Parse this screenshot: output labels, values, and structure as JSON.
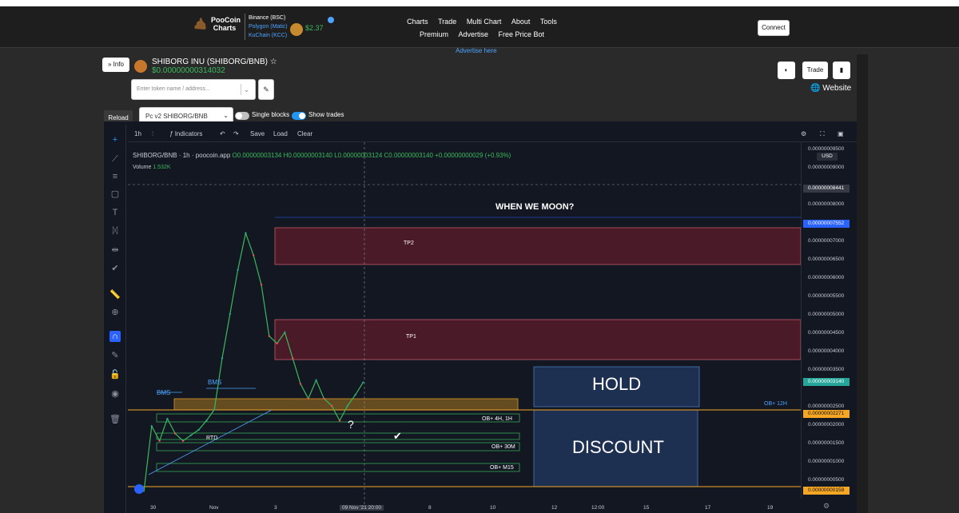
{
  "header": {
    "logo": {
      "line1": "PooCoin",
      "line2": "Charts"
    },
    "chains": [
      "Binance (BSC)",
      "Polygon (Matic)",
      "KuChain (KCC)"
    ],
    "poo_price": "$2.37",
    "nav_row1": [
      "Charts",
      "Trade",
      "Multi Chart",
      "About",
      "Tools"
    ],
    "nav_row2": [
      "Premium",
      "Advertise",
      "Free Price Bot"
    ],
    "connect_label": "Connect",
    "advertise_here": "Advertise here"
  },
  "token": {
    "info_label": "Info",
    "name": "SHIBORG INU (SHIBORG/BNB)",
    "price": "$0.00000000314032",
    "search_placeholder": "Enter token name / address...",
    "trade_label": "Trade",
    "website_label": "Website"
  },
  "controls": {
    "reload_label": "Reload",
    "pair_selected": "Pc v2 SHIBORG/BNB",
    "single_blocks_label": "Single blocks",
    "show_trades_label": "Show trades",
    "single_blocks_on": false,
    "show_trades_on": true
  },
  "chart_toolbar": {
    "interval": "1h",
    "indicators_label": "Indicators",
    "save_label": "Save",
    "load_label": "Load",
    "clear_label": "Clear"
  },
  "legend": {
    "symbol": "SHIBORG/BNB",
    "interval": "1h",
    "source": "poocoin.app",
    "open": "O0.00000003134",
    "high": "H0.00000003140",
    "low": "L0.00000003124",
    "close": "C0.00000003140",
    "change": "+0.00000000029 (+0.93%)",
    "volume_label": "Volume",
    "volume_value": "1.532K"
  },
  "chart_data": {
    "type": "candlestick",
    "currency": "USD",
    "price_ticks": [
      "0.00000009500",
      "0.00000009000",
      "0.00000008000",
      "0.00000007000",
      "0.00000006500",
      "0.00000006000",
      "0.00000005500",
      "0.00000005000",
      "0.00000004500",
      "0.00000004000",
      "0.00000003500",
      "0.00000002500",
      "0.00000002000",
      "0.00000001500",
      "0.00000001000",
      "0.00000000500"
    ],
    "time_ticks": [
      "30",
      "Nov",
      "3",
      "8",
      "10",
      "12",
      "12:00",
      "15",
      "17",
      "19"
    ],
    "crosshair_time_label": "09 Nov '21  20:00",
    "price_tags": [
      {
        "label": "0.00000008441",
        "color": "#363a45"
      },
      {
        "label": "0.00000007552",
        "color": "#2962ff"
      },
      {
        "label": "0.00000003140",
        "color": "#26a69a"
      },
      {
        "label": "0.00000002271",
        "color": "#f5a623"
      },
      {
        "label": "0.00000000159",
        "color": "#f5a623"
      }
    ],
    "price_series": [
      {
        "t": 0,
        "p": 1.59e-09
      },
      {
        "t": 1,
        "p": 1.95e-08
      },
      {
        "t": 2,
        "p": 1.55e-08
      },
      {
        "t": 3,
        "p": 2.15e-08
      },
      {
        "t": 4,
        "p": 1.75e-08
      },
      {
        "t": 5,
        "p": 1.55e-08
      },
      {
        "t": 6,
        "p": 1.7e-08
      },
      {
        "t": 7,
        "p": 1.85e-08
      },
      {
        "t": 8,
        "p": 2.1e-08
      },
      {
        "t": 9,
        "p": 2.4e-08
      },
      {
        "t": 10,
        "p": 3.8e-08
      },
      {
        "t": 11,
        "p": 5e-08
      },
      {
        "t": 12,
        "p": 6.2e-08
      },
      {
        "t": 13,
        "p": 7.2e-08
      },
      {
        "t": 14,
        "p": 6.6e-08
      },
      {
        "t": 15,
        "p": 5.8e-08
      },
      {
        "t": 16,
        "p": 4.4e-08
      },
      {
        "t": 17,
        "p": 4.2e-08
      },
      {
        "t": 18,
        "p": 4.5e-08
      },
      {
        "t": 19,
        "p": 3.8e-08
      },
      {
        "t": 20,
        "p": 3.1e-08
      },
      {
        "t": 21,
        "p": 2.7e-08
      },
      {
        "t": 22,
        "p": 3.2e-08
      },
      {
        "t": 23,
        "p": 2.7e-08
      },
      {
        "t": 24,
        "p": 2.5e-08
      },
      {
        "t": 25,
        "p": 2.1e-08
      },
      {
        "t": 26,
        "p": 2.5e-08
      },
      {
        "t": 27,
        "p": 2.8e-08
      },
      {
        "t": 28,
        "p": 3.14e-08
      }
    ],
    "annotations": {
      "moon": "WHEN WE MOON?",
      "tp2": "TP2",
      "tp1": "TP1",
      "hold": "HOLD",
      "discount": "DISCOUNT",
      "bms1": "BMS",
      "bms2": "BMS",
      "rtd": "RTD",
      "question": "?",
      "ob_4h": "OB+ 4H, 1H",
      "ob_30m": "OB+ 30M",
      "ob_m15": "OB+ M15",
      "ob_12h": "OB+ 12H",
      "check": "✔"
    }
  }
}
